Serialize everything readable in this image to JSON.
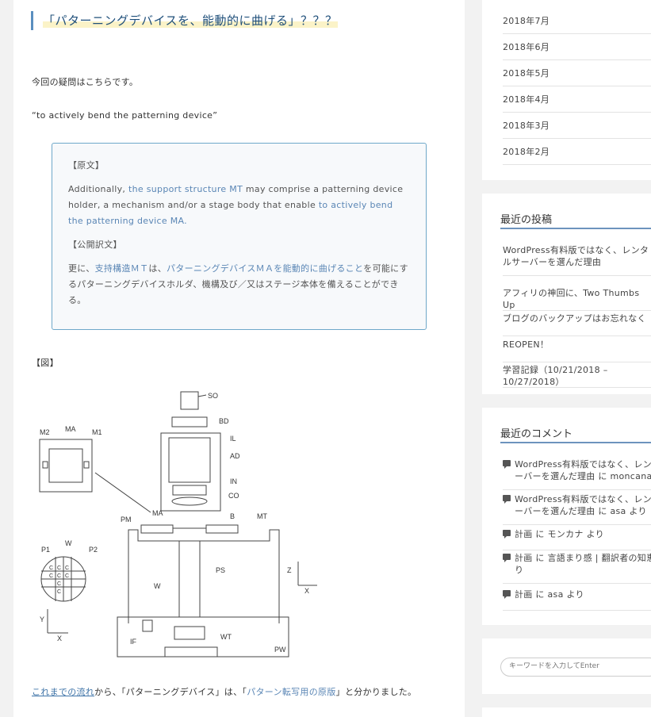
{
  "article": {
    "title": "「パターニングデバイスを、能動的に曲げる」？？？",
    "intro": "今回の疑問はこちらです。",
    "phrase": "“to actively bend the patterning device”",
    "quote": {
      "original_heading": "【原文】",
      "original_pre": "Additionally, ",
      "original_hl1": "the support structure MT",
      "original_mid": " may comprise a patterning device holder, a mechanism and/or a stage body that enable ",
      "original_hl2": "to actively bend the patterning device MA.",
      "translation_heading": "【公開訳文】",
      "translation_pre": "更に、",
      "translation_hl1": "支持構造ＭＴ",
      "translation_mid1": "は、",
      "translation_hl2": "パターニングデバイスＭＡを能動的に曲げること",
      "translation_post": "を可能にするパターニングデバイスホルダ、機構及び／又はステージ本体を備えることができる。"
    },
    "figure_heading": "【図】",
    "figure_labels": {
      "so": "SO",
      "bd": "BD",
      "il": "IL",
      "ad": "AD",
      "in": "IN",
      "co": "CO",
      "m2": "M2",
      "ma": "MA",
      "m1": "M1",
      "ma2": "MA",
      "pm": "PM",
      "b": "B",
      "mt": "MT",
      "p1": "P1",
      "w": "W",
      "p2": "P2",
      "ps": "PS",
      "z": "Z",
      "x": "X",
      "w2": "W",
      "y": "Y",
      "x2": "X",
      "wt": "WT",
      "if": "IF",
      "pw": "PW",
      "grid_c": "C"
    },
    "conclusion": {
      "link": "これまでの流れ",
      "mid1": "から、「パターニングデバイス」は、「",
      "hl": "パターン転写用の原版",
      "mid2": "」と分かりました。"
    }
  },
  "sidebar": {
    "archives": [
      "2018年7月",
      "2018年6月",
      "2018年5月",
      "2018年4月",
      "2018年3月",
      "2018年2月"
    ],
    "recent_posts_title": "最近の投稿",
    "recent_posts": [
      "WordPress有料版ではなく、レンタルサーバーを選んだ理由",
      "アフィリの神回に、Two Thumbs Up",
      "ブログのバックアップはお忘れなく",
      "REOPEN！",
      "学習記録（10/21/2018 – 10/27/2018）"
    ],
    "recent_comments_title": "最近のコメント",
    "recent_comments": [
      {
        "line1": "WordPress有料版ではなく、レンタ",
        "line2": "ーバーを選んだ理由 に moncana よ"
      },
      {
        "line1": "WordPress有料版ではなく、レンタ",
        "line2": "ーバーを選んだ理由 に asa より"
      },
      {
        "line1": "計画 に モンカナ より",
        "line2": ""
      },
      {
        "line1": "計画 に 言語まり感 | 翻訳者の知恵袋",
        "line2": "り"
      },
      {
        "line1": "計画 に asa より",
        "line2": ""
      }
    ],
    "search_placeholder": "キーワードを入力してEnter"
  }
}
